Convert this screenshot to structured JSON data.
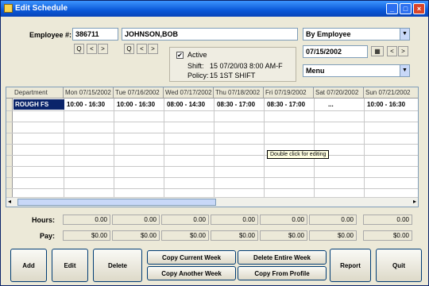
{
  "window": {
    "title": "Edit Schedule",
    "minimize": "_",
    "maximize": "□",
    "close": "×"
  },
  "employee": {
    "label": "Employee #:",
    "number": "386711",
    "name": "JOHNSON,BOB"
  },
  "view": {
    "selected": "By Employee"
  },
  "date": {
    "value": "07/15/2002",
    "menu_value": "Menu"
  },
  "nav": {
    "find": "Q",
    "prev": "<",
    "next": ">"
  },
  "status": {
    "active_label": "Active",
    "checked": "✔",
    "shift_label": "Shift:",
    "shift_value": "15   07/20/03 8:00 AM-F",
    "policy_label": "Policy:",
    "policy_value": "15   1ST SHIFT"
  },
  "grid": {
    "columns": [
      "Department",
      "Mon 07/15/2002",
      "Tue 07/16/2002",
      "Wed 07/17/2002",
      "Thu 07/18/2002",
      "Fri 07/19/2002",
      "Sat 07/20/2002",
      "Sun 07/21/2002"
    ],
    "rows": [
      {
        "dept": "ROUGH FS",
        "cells": [
          "10:00 - 16:30",
          "10:00 - 16:30",
          "08:00 - 14:30",
          "08:30 - 17:00",
          "08:30 - 17:00",
          "...",
          "10:00 - 16:30"
        ]
      }
    ],
    "tooltip": "Double click for editing"
  },
  "summary": {
    "hours_label": "Hours:",
    "pay_label": "Pay:",
    "hours": [
      "0.00",
      "0.00",
      "0.00",
      "0.00",
      "0.00",
      "0.00",
      "",
      "0.00"
    ],
    "pay": [
      "$0.00",
      "$0.00",
      "$0.00",
      "$0.00",
      "$0.00",
      "$0.00",
      "",
      "$0.00"
    ]
  },
  "buttons": {
    "add": "Add",
    "edit": "Edit",
    "delete": "Delete",
    "copy_current": "Copy Current Week",
    "copy_another": "Copy Another Week",
    "delete_entire": "Delete Entire Week",
    "copy_profile": "Copy From Profile",
    "report": "Report",
    "quit": "Quit"
  }
}
